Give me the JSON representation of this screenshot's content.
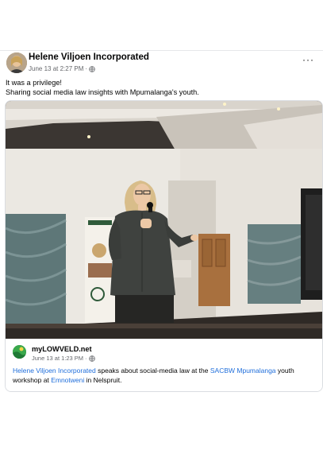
{
  "post": {
    "author": "Helene Viljoen Incorporated",
    "timestamp": "June 13 at 2:27 PM",
    "separator": "·",
    "privacy_icon": "globe-icon",
    "more_icon": "more-horizontal-icon",
    "more_label": "···",
    "caption_lines": [
      "It was a privilege!",
      "Sharing social media law insights with Mpumalanga's youth."
    ]
  },
  "shared": {
    "site_name": "myLOWVELD.net",
    "timestamp": "June 13 at 1:23 PM",
    "separator": "·",
    "privacy_icon": "globe-icon",
    "text": {
      "mention1": "Helene Viljoen Incorporated",
      "part1": " speaks about social-media law at the ",
      "mention2": "SACBW Mpumalanga",
      "part2": " youth workshop at ",
      "mention3": "Emnotweni",
      "part3": " in Nelspruit."
    }
  },
  "colors": {
    "link": "#216fdb",
    "meta": "#65676b",
    "text": "#050505",
    "site_logo": "#3aa84c"
  }
}
